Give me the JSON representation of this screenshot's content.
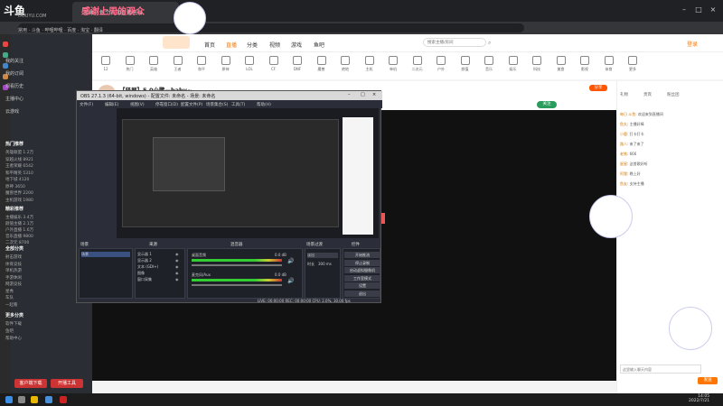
{
  "browser": {
    "logo": "斗鱼",
    "logo_sub": "DOUYU.COM",
    "tab_title": "斗鱼 - 每个人的直播平台",
    "promo": "感谢上周的观众",
    "bookmarks": "常用 · 斗鱼 · 哔哩哔哩 · 百度 · 淘宝 · 翻译"
  },
  "nav": {
    "items": [
      "首页",
      "直播",
      "分类",
      "视频",
      "游戏",
      "鱼吧"
    ],
    "search_placeholder": "搜索主播/房间",
    "login": "登录"
  },
  "categories": [
    "12",
    "热门",
    "英雄",
    "王者",
    "和平",
    "原神",
    "LOL",
    "CF",
    "DNF",
    "魔兽",
    "绝地",
    "主机",
    "单机",
    "二次元",
    "户外",
    "颜值",
    "音乐",
    "娱乐",
    "科技",
    "美食",
    "影视",
    "体育",
    "更多"
  ],
  "room": {
    "title": "【竖屏】5.0小鹏—baby~",
    "meta": "分区 · 颜值 · 房间号",
    "follow": "关注",
    "share": "分享"
  },
  "sidebar": {
    "items": [
      "我的关注",
      "我的订阅",
      "观看历史",
      "主播中心",
      "云游戏"
    ],
    "section1": "热门推荐",
    "rows1": [
      "英雄联盟 1.2万",
      "穿越火线 8921",
      "王者荣耀 6542",
      "和平精英 5310",
      "地下城 4120",
      "原神 3650",
      "魔兽世界 2200",
      "主机游戏 1980"
    ],
    "section2": "精彩推荐",
    "rows2": [
      "主播娱乐 3.4万",
      "颜值主播 2.1万",
      "户外直播 1.6万",
      "音乐直播 9800",
      "二次元 8700"
    ],
    "section3": "全部分类",
    "rows3": [
      "射击游戏",
      "体育竞技",
      "单机热游",
      "手游休闲",
      "网游竞技",
      "星秀",
      "车队",
      "一起看"
    ],
    "section4": "更多分类",
    "rows4": [
      "软件下载",
      "鱼吧",
      "帮助中心"
    ],
    "btn1": "客户端下载",
    "btn2": "开播工具"
  },
  "obs": {
    "title": "OBS 27.1.3 (64-bit, windows) - 配置文件: 未命名 - 场景: 未命名",
    "menu": [
      "文件(F)",
      "编辑(E)",
      "视图(V)",
      "停靠窗口(D)",
      "配置文件(P)",
      "场景集合(S)",
      "工具(T)",
      "帮助(H)"
    ],
    "panels": [
      "场景",
      "来源",
      "混音器",
      "场景过渡",
      "控件"
    ],
    "scene": "场景",
    "sources": [
      "显示器 1",
      "显示器 2",
      "文本 (GDI+)",
      "图像",
      "窗口采集"
    ],
    "mixer": [
      "桌面音频",
      "麦克风/Aux"
    ],
    "mixer_db": [
      "0.0 dB",
      "0.0 dB"
    ],
    "transition": "淡出",
    "duration_label": "时长",
    "duration": "300 ms",
    "controls": [
      "开始推流",
      "停止录制",
      "启动虚拟摄像机",
      "工作室模式",
      "设置",
      "退出"
    ],
    "status": "LIVE: 00:00:00  REC: 00:00:00  CPU: 2.0%, 30.00 fps"
  },
  "chat": {
    "tabs": [
      "礼物",
      "贵宾",
      "粉丝团"
    ],
    "lines": [
      {
        "name": "每日 斗鱼",
        "text": "欢迎来到直播间"
      },
      {
        "name": "鱼丸",
        "text": "主播好棒"
      },
      {
        "name": "小鹿",
        "text": "打卡打卡"
      },
      {
        "name": "路人",
        "text": "来了来了"
      },
      {
        "name": "老铁",
        "text": "666"
      },
      {
        "name": "星星",
        "text": "这首歌好听"
      },
      {
        "name": "阿狸",
        "text": "晚上好"
      },
      {
        "name": "鱼友",
        "text": "支持主播"
      }
    ],
    "input_placeholder": "这里输入聊天内容",
    "send": "发送"
  },
  "taskbar": {
    "time": "14:05",
    "date": "2022/7/21"
  },
  "colors": {
    "brand": "#ff7700",
    "obs_bg": "#2b2e38",
    "chrome": "#202124"
  }
}
